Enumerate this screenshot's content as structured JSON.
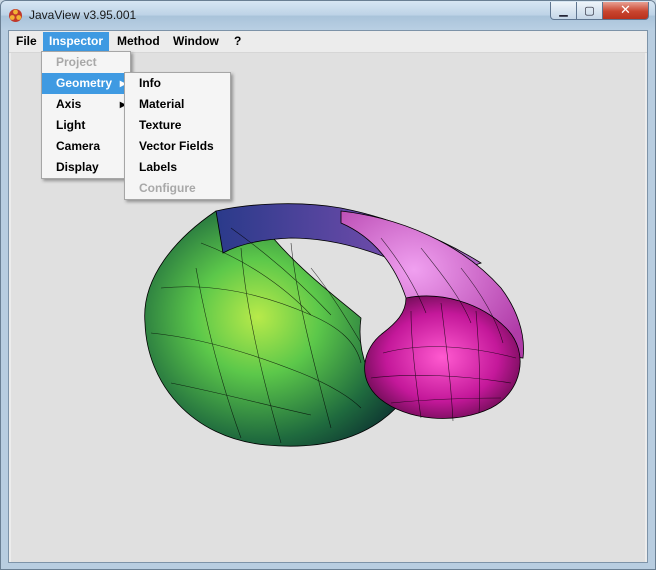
{
  "window": {
    "title": "JavaView v3.95.001",
    "minimize_glyph": "▁",
    "maximize_glyph": "▢",
    "close_glyph": "✕"
  },
  "menubar": {
    "items": [
      {
        "label": "File"
      },
      {
        "label": "Inspector",
        "active": true
      },
      {
        "label": "Method"
      },
      {
        "label": "Window"
      },
      {
        "label": "?"
      }
    ]
  },
  "inspector_menu": {
    "items": [
      {
        "label": "Project",
        "disabled": true
      },
      {
        "label": "Geometry",
        "selected": true,
        "submenu": true
      },
      {
        "label": "Axis",
        "submenu": true
      },
      {
        "label": "Light"
      },
      {
        "label": "Camera"
      },
      {
        "label": "Display"
      }
    ]
  },
  "geometry_submenu": {
    "items": [
      {
        "label": "Info"
      },
      {
        "label": "Material"
      },
      {
        "label": "Texture"
      },
      {
        "label": "Vector Fields"
      },
      {
        "label": "Labels"
      },
      {
        "label": "Configure",
        "disabled": true
      }
    ]
  },
  "icons": {
    "app": "javaview-app-icon",
    "submenu_arrow": "submenu-arrow-icon"
  },
  "colors": {
    "menu_highlight": "#3f9ae2",
    "shell_green": "#5cc84a",
    "shell_magenta": "#c4189a",
    "shell_navy": "#2a3a8a"
  }
}
